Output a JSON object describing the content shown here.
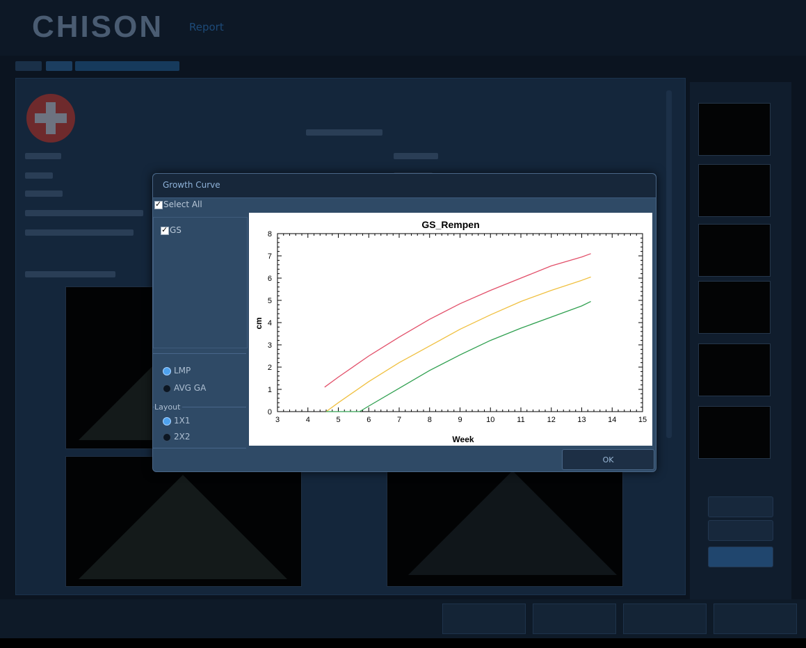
{
  "app": {
    "brand": "CHISON",
    "module": "Report"
  },
  "dialog": {
    "title": "Growth Curve",
    "select_all_label": "Select All",
    "items": [
      {
        "label": "GS",
        "checked": true
      }
    ],
    "ga_basis": {
      "options": [
        {
          "label": "LMP",
          "selected": true
        },
        {
          "label": "AVG GA",
          "selected": false
        }
      ]
    },
    "layout": {
      "label": "Layout",
      "options": [
        {
          "label": "1X1",
          "selected": true
        },
        {
          "label": "2X2",
          "selected": false
        }
      ]
    },
    "ok_label": "OK"
  },
  "chart_data": {
    "type": "line",
    "title": "GS_Rempen",
    "xlabel": "Week",
    "ylabel": "cm",
    "xlim": [
      3,
      15
    ],
    "ylim": [
      0,
      8
    ],
    "xticks": [
      3,
      4,
      5,
      6,
      7,
      8,
      9,
      10,
      11,
      12,
      13,
      14,
      15
    ],
    "yticks": [
      0,
      1,
      2,
      3,
      4,
      5,
      6,
      7,
      8
    ],
    "grid": false,
    "legend": "none",
    "series": [
      {
        "color": "#e2506a",
        "x": [
          4.55,
          5,
          6,
          7,
          8,
          9,
          10,
          11,
          12,
          13,
          13.3
        ],
        "y": [
          1.1,
          1.55,
          2.5,
          3.35,
          4.15,
          4.85,
          5.45,
          6.0,
          6.55,
          6.95,
          7.1
        ]
      },
      {
        "color": "#f0c040",
        "x": [
          4.6,
          5,
          6,
          7,
          8,
          9,
          10,
          11,
          12,
          13,
          13.3
        ],
        "y": [
          0.0,
          0.4,
          1.35,
          2.2,
          2.95,
          3.7,
          4.35,
          4.95,
          5.45,
          5.9,
          6.05
        ]
      },
      {
        "color": "#30a050",
        "x": [
          4.6,
          5.7,
          6,
          7,
          8,
          9,
          10,
          11,
          12,
          13,
          13.3
        ],
        "y": [
          0.0,
          0.0,
          0.25,
          1.05,
          1.85,
          2.55,
          3.2,
          3.75,
          4.25,
          4.75,
          4.95
        ]
      }
    ]
  }
}
